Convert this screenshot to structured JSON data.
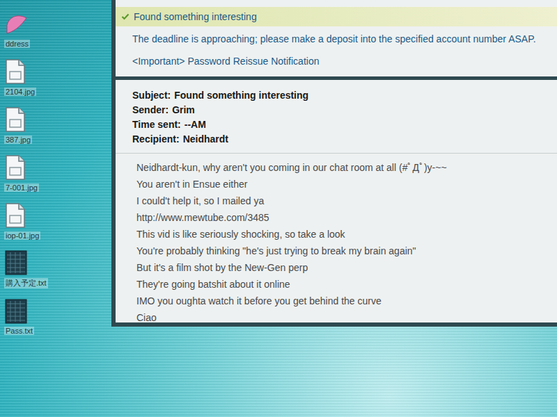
{
  "desktop": {
    "icons": [
      {
        "label": "ddress",
        "kind": "app"
      },
      {
        "label": "2104.jpg",
        "kind": "image"
      },
      {
        "label": "387.jpg",
        "kind": "image"
      },
      {
        "label": "7-001.jpg",
        "kind": "image"
      },
      {
        "label": "iop-01.jpg",
        "kind": "image"
      },
      {
        "label": "購入予定.txt",
        "kind": "text"
      },
      {
        "label": "Pass.txt",
        "kind": "text"
      }
    ]
  },
  "mail_list": [
    {
      "subject": "Found something interesting",
      "selected": true
    },
    {
      "subject": "The deadline is approaching; please make a deposit into the specified account number ASAP.",
      "selected": false
    },
    {
      "subject": "<Important> Password Reissue Notification",
      "selected": false
    }
  ],
  "message": {
    "headers": [
      {
        "label": "Subject:",
        "value": "Found something interesting"
      },
      {
        "label": "Sender:",
        "value": "Grim"
      },
      {
        "label": "Time sent:",
        "value": "--AM"
      },
      {
        "label": "Recipient:",
        "value": "Neidhardt"
      }
    ],
    "body": [
      "Neidhardt-kun, why aren't you coming in our chat room at all (#ﾟДﾟ)y-~~",
      "You aren't in Ensue either",
      "I could't help it, so I mailed ya",
      "http://www.mewtube.com/3485",
      "This vid is like seriously shocking, so take a look",
      "You're probably thinking \"he's just trying to break my brain again\"",
      "But it's a film shot by the New-Gen perp",
      "They're going batshit about it online",
      "IMO you oughta watch it before you get behind the curve",
      "Ciao"
    ]
  }
}
